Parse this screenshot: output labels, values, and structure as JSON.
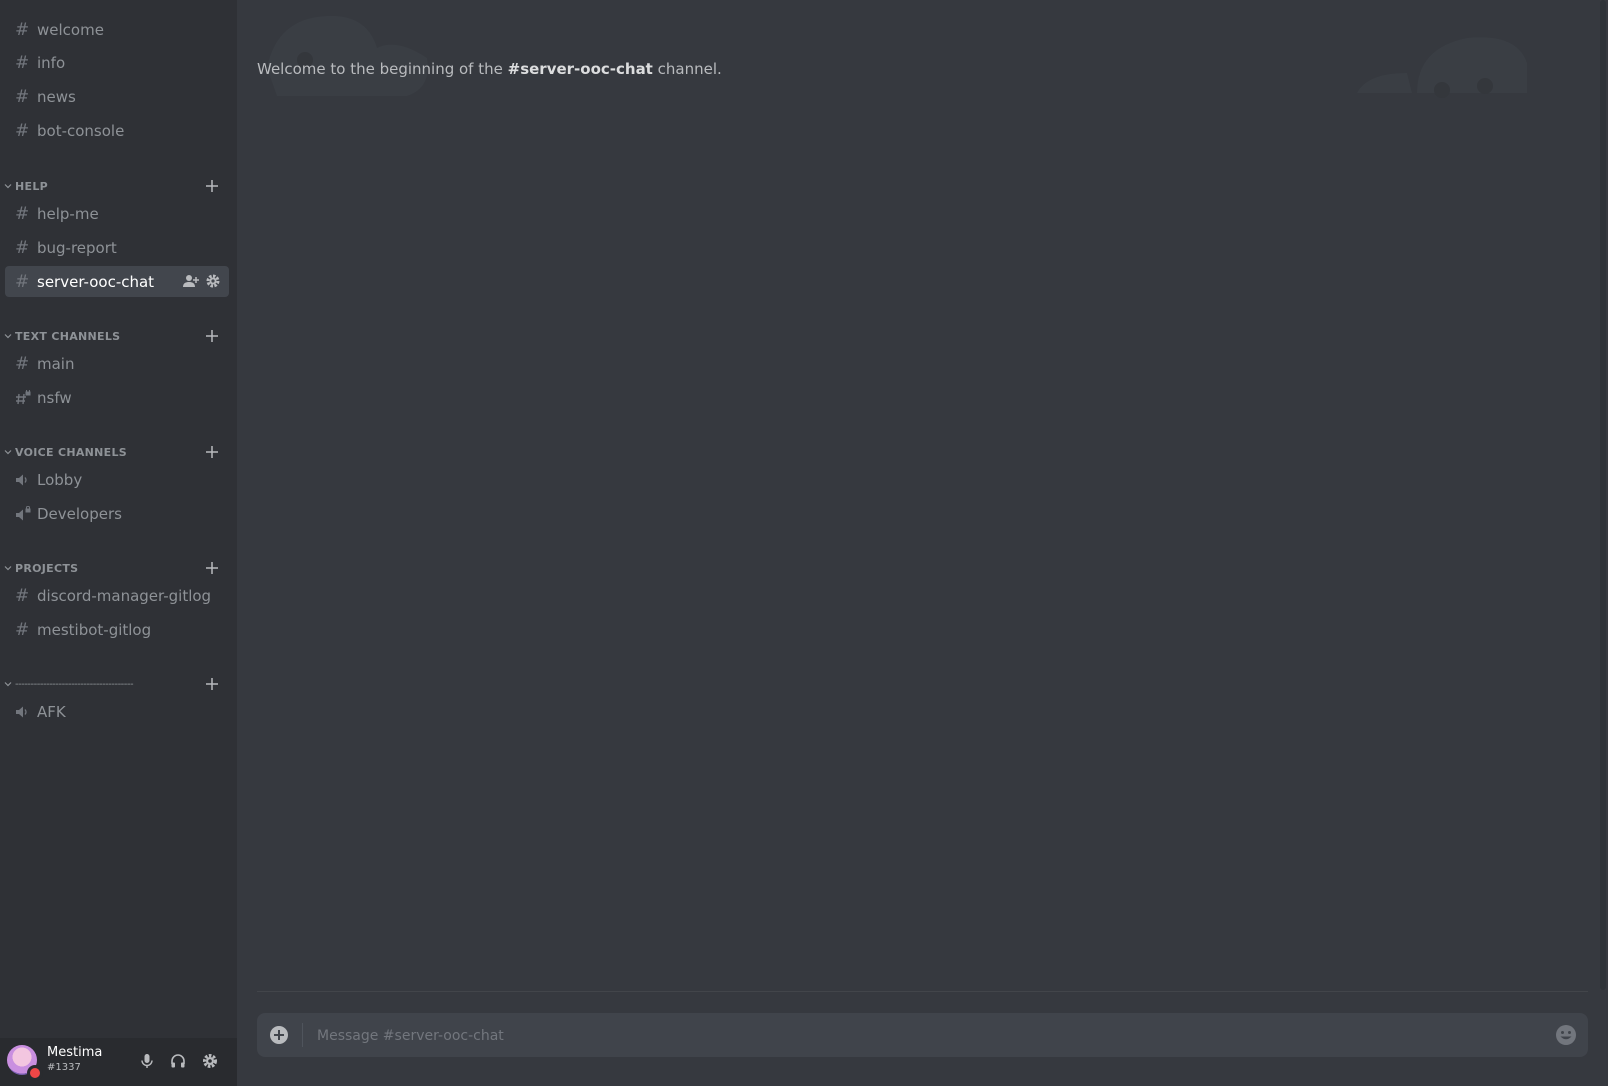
{
  "sidebar": {
    "top_channels": [
      {
        "label": "welcome",
        "icon": "hash-icon"
      },
      {
        "label": "info",
        "icon": "hash-icon"
      },
      {
        "label": "news",
        "icon": "hash-icon"
      },
      {
        "label": "bot-console",
        "icon": "hash-icon"
      }
    ],
    "categories": [
      {
        "label": "HELP",
        "channels": [
          {
            "label": "help-me",
            "icon": "hash-icon"
          },
          {
            "label": "bug-report",
            "icon": "hash-icon"
          },
          {
            "label": "server-ooc-chat",
            "icon": "hash-icon",
            "selected": true
          }
        ]
      },
      {
        "label": "TEXT CHANNELS",
        "channels": [
          {
            "label": "main",
            "icon": "hash-icon"
          },
          {
            "label": "nsfw",
            "icon": "locked-hash-icon"
          }
        ]
      },
      {
        "label": "VOICE CHANNELS",
        "channels": [
          {
            "label": "Lobby",
            "icon": "speaker-icon"
          },
          {
            "label": "Developers",
            "icon": "locked-speaker-icon"
          }
        ]
      },
      {
        "label": "PROJECTS",
        "channels": [
          {
            "label": "discord-manager-gitlog",
            "icon": "hash-icon"
          },
          {
            "label": "mestibot-gitlog",
            "icon": "hash-icon"
          }
        ]
      },
      {
        "label": "--------------------------------------",
        "channels": [
          {
            "label": "AFK",
            "icon": "speaker-icon"
          }
        ]
      }
    ]
  },
  "user": {
    "name": "Mestima",
    "tag": "#1337",
    "status_color": "#f04747"
  },
  "main": {
    "welcome_prefix": "Welcome to the beginning of the ",
    "welcome_channel": "#server-ooc-chat",
    "welcome_suffix": " channel.",
    "message_placeholder": "Message #server-ooc-chat"
  },
  "colors": {
    "sidebar_bg": "#2f3136",
    "main_bg": "#36393f",
    "selected_bg": "#42464d",
    "input_bg": "#40444b"
  }
}
